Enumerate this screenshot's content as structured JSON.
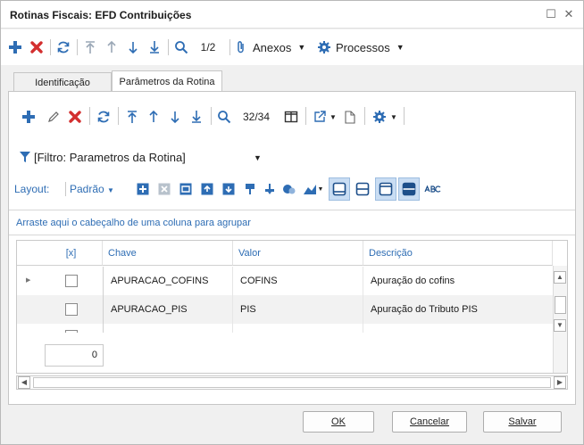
{
  "window": {
    "title": "Rotinas Fiscais: EFD Contribuições",
    "maximize_glyph": "☐",
    "close_glyph": "✕"
  },
  "toolbar_main": {
    "record_position": "1/2",
    "anexos_label": "Anexos",
    "processos_label": "Processos",
    "icons": [
      "add-icon",
      "delete-icon",
      "refresh-icon",
      "first-record-icon",
      "previous-record-icon",
      "next-record-icon",
      "last-record-icon",
      "search-icon",
      "paperclip-icon",
      "gear-icon"
    ]
  },
  "tabs": [
    {
      "label": "Identificação",
      "active": false
    },
    {
      "label": "Parâmetros da Rotina",
      "active": true
    }
  ],
  "toolbar_grid": {
    "record_position": "32/34"
  },
  "filter": {
    "label": "[Filtro: Parametros da Rotina]"
  },
  "layout": {
    "label": "Layout:",
    "value": "Padrão"
  },
  "group_hint": "Arraste aqui o cabeçalho de uma coluna para agrupar",
  "grid": {
    "columns": [
      "[x]",
      "Chave",
      "Valor",
      "Descrição"
    ],
    "rows": [
      {
        "checked": false,
        "chave": "APURACAO_COFINS",
        "valor": "COFINS",
        "descricao": "Apuração do cofins",
        "current": true
      },
      {
        "checked": false,
        "chave": "APURACAO_PIS",
        "valor": "PIS",
        "descricao": "Apuração do Tributo PIS",
        "current": false
      }
    ],
    "row_count": "0"
  },
  "buttons": {
    "ok_label": "OK",
    "cancel_label": "Cancelar",
    "save_label": "Salvar"
  },
  "colors": {
    "accent_blue": "#2e6db4",
    "delete_red": "#d32f2f",
    "toggle_active": "#c9ddf3"
  }
}
